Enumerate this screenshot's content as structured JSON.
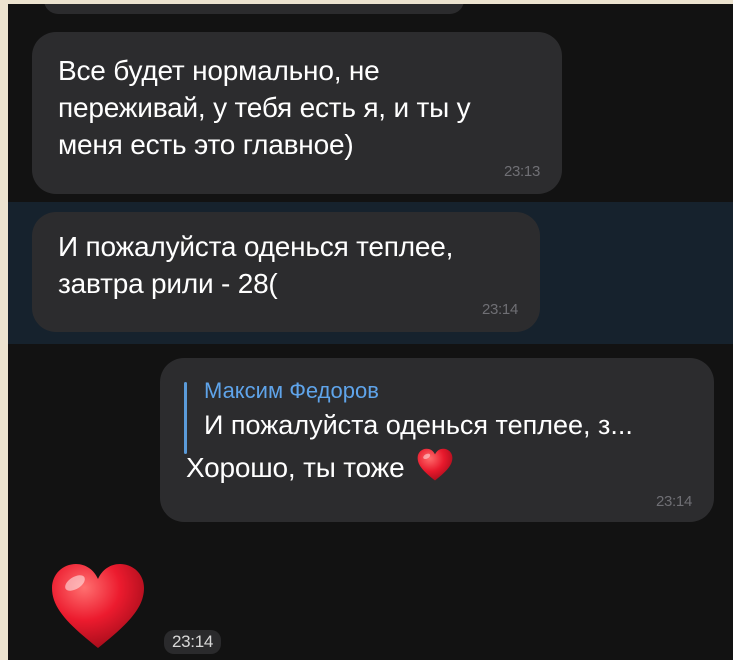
{
  "chat": {
    "messages": [
      {
        "text": "Все будет нормально, не\nпереживай, у тебя есть я, и ты у\nменя есть это главное)",
        "time": "23:13"
      },
      {
        "text": "И пожалуйста оденься теплее,\nзавтра рили - 28(",
        "time": "23:14"
      },
      {
        "reply_author": "Максим Федоров",
        "reply_text": "И пожалуйста оденься теплее, з...",
        "text": "Хорошо, ты тоже",
        "emoji_icon": "heart-icon",
        "time": "23:14"
      },
      {
        "emoji_icon": "heart-icon",
        "time": "23:14"
      }
    ]
  },
  "colors": {
    "background": "#121212",
    "bubble": "#2c2c2e",
    "highlight": "#16222d",
    "reply_accent": "#5fa4ea",
    "heart": "#e8192c"
  }
}
